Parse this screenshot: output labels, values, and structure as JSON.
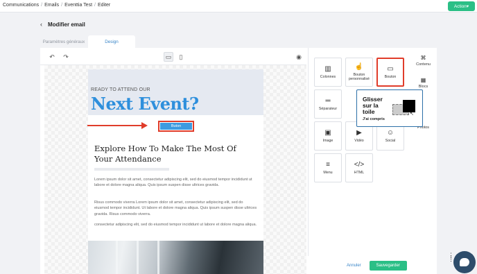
{
  "breadcrumb": [
    "Communications",
    "Emails",
    "Eventtia Test",
    "Editer"
  ],
  "action_button": "Action",
  "page_title": "Modifier email",
  "tabs": {
    "general": "Paramètres généraux",
    "design": "Design"
  },
  "email": {
    "ready": "READY TO ATTEND OUR",
    "headline": "Next Event?",
    "button_label": "Buton",
    "subheading": "Explore How To Make The Most Of Your Attendance",
    "paragraphs": [
      "Lorem ipsum dolor sit amet, consectetur adipiscing elit, sed do eiusmod tempor incididunt ut labore et dolore magna aliqua. Quis ipsum suspen disse ultrices gravida.",
      "Risus commodo viverra Lorem ipsum dolor sit amet, consectetur adipiscing elit, sed do eiusmod tempor incididunt. Ut labore et dolore magna aliqua. Quis ipsum suspen disse ultrices gravida. Risus commodo viverra.",
      "consectetur adipiscing elit, sed do eiusmod tempor incididunt ut labore et dolore magna aliqua."
    ]
  },
  "blocks": {
    "colonnes": "Colonnes",
    "bouton_perso": "Bouton personnalisé",
    "bouton": "Bouton",
    "separateur": "Séparateur",
    "image": "Image",
    "video": "Vidéo",
    "social": "Social",
    "menu": "Menu",
    "html": "HTML"
  },
  "side_tabs": {
    "contenu": "Contenu",
    "blocs": "Blocs",
    "photos": "Photos"
  },
  "tooltip": {
    "title": "Glisser sur la toile",
    "ok": "J'ai compris"
  },
  "footer": {
    "cancel": "Annuler",
    "save": "Sauvegarder"
  },
  "icons": {
    "undo": "undo-icon",
    "redo": "redo-icon",
    "desktop": "desktop-icon",
    "mobile": "mobile-icon",
    "preview": "eye-icon",
    "back": "arrow-left-icon",
    "chat": "chat-icon"
  },
  "colors": {
    "accent_green": "#2bbf86",
    "highlight_red": "#e03c2a",
    "headline_blue": "#2e8fdc",
    "tooltip_border": "#2c6fa8"
  }
}
